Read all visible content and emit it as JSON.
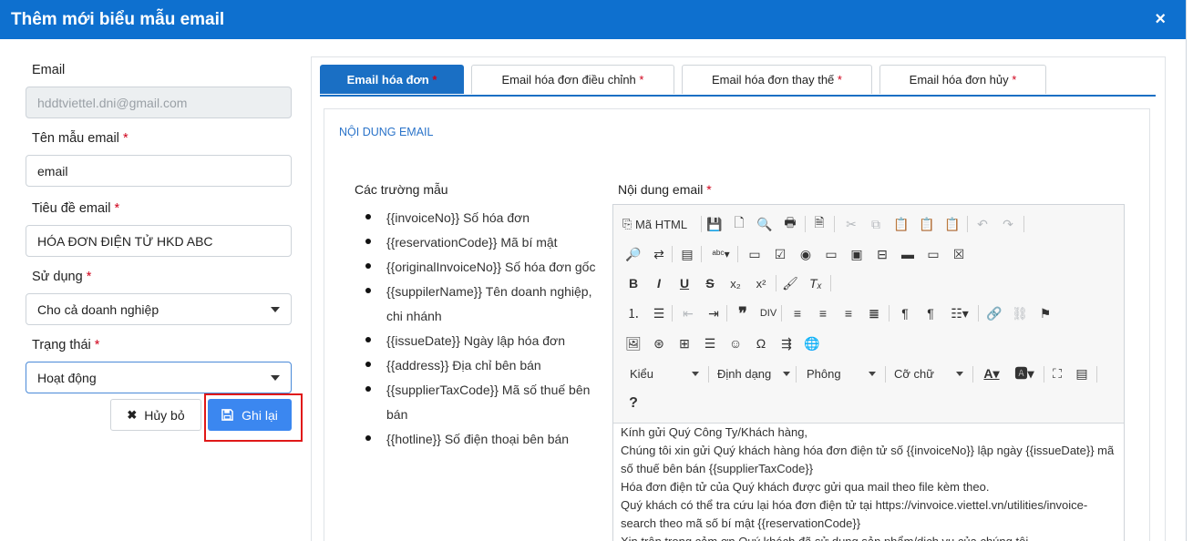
{
  "modal": {
    "title": "Thêm mới biểu mẫu email",
    "close_icon": "×"
  },
  "form": {
    "email_label": "Email",
    "email_value": "hddtviettel.dni@gmail.com",
    "template_name_label": "Tên mẫu email",
    "template_name_value": "email",
    "subject_label": "Tiêu đề email",
    "subject_value": "HÓA ĐƠN ĐIỆN TỬ HKD ABC",
    "usage_label": "Sử dụng",
    "usage_value": "Cho cả doanh nghiệp",
    "status_label": "Trạng thái",
    "status_value": "Hoạt động",
    "required_mark": "*",
    "cancel_label": "Hủy bỏ",
    "save_label": "Ghi lại"
  },
  "tabs": [
    {
      "label": "Email hóa đơn",
      "active": true
    },
    {
      "label": "Email hóa đơn điều chỉnh",
      "active": false
    },
    {
      "label": "Email hóa đơn thay thế",
      "active": false
    },
    {
      "label": "Email hóa đơn hủy",
      "active": false
    }
  ],
  "content": {
    "section_title": "NỘI DUNG EMAIL",
    "fields_title": "Các trường mẫu",
    "fields": [
      "{{invoiceNo}} Số hóa đơn",
      "{{reservationCode}} Mã bí mật",
      "{{originalInvoiceNo}} Số hóa đơn gốc",
      "{{suppilerName}} Tên doanh nghiệp, chi nhánh",
      "{{issueDate}} Ngày lập hóa đơn",
      "{{address}} Địa chỉ bên bán",
      "{{supplierTaxCode}} Mã số thuế bên bán",
      "{{hotline}} Số điện thoại bên bán"
    ],
    "email_content_label": "Nội dung email"
  },
  "editor": {
    "source_label": "Mã HTML",
    "style_combo": "Kiểu",
    "format_combo": "Định dạng",
    "font_combo": "Phông",
    "size_combo": "Cỡ chữ",
    "help": "?",
    "body_lines": [
      "Kính gửi Quý Công Ty/Khách hàng,",
      "Chúng tôi xin gửi Quý khách hàng hóa đơn điện tử số {{invoiceNo}} lập ngày {{issueDate}} mã số thuế bên bán {{supplierTaxCode}}",
      "Hóa đơn điện tử của Quý khách được gửi qua mail theo file kèm theo.",
      "Quý khách có thể tra cứu lại hóa đơn điện tử tại https://vinvoice.viettel.vn/utilities/invoice-search theo mã số bí mật {{reservationCode}}",
      "Xin trân trọng cảm ơn Quý khách đã sử dụng sản phẩm/dịch vụ của chúng tôi."
    ]
  },
  "colors": {
    "header": "#0e70cf",
    "tab_active": "#1a6fc4",
    "save_button": "#3b87f0",
    "required": "#d0021b",
    "highlight": "#e01818"
  }
}
